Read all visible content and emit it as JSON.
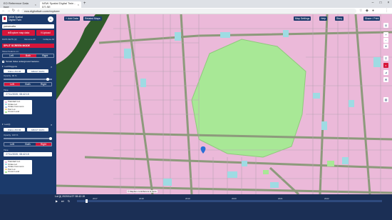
{
  "browser": {
    "tabs": [
      {
        "label": "EO Reference Data type"
      },
      {
        "label": "NSW Spatial Digital Twin - DT-SE"
      }
    ],
    "url": "nsw.digitaltwin.com/explorer"
  },
  "panel": {
    "app_title_line1": "NSW Spatial",
    "app_title_line2": "Digital Twin",
    "search_value": "parramatta",
    "explore_btn": "Explore map data",
    "upload_btn": "Upload",
    "data_sets": "DATA SETS (2)",
    "remove_all": "Remove All",
    "collapse_all": "Collapse All",
    "split_title": "SPLIT SCREEN MODE",
    "show_feature_on": "Show Feature on:",
    "sides": [
      "Left",
      "Both",
      "Right"
    ],
    "terrain_check": "Terrain hides underground features",
    "layer1_name": "Lot Polygons",
    "ideal_zoom": "IDEAL ZOOM",
    "about_data": "ABOUT DATA",
    "opacity": "Opacity: 90 %",
    "time_label": "Time",
    "time1": "27/11/2020, 08:42:15",
    "legend_items": [
      "Standard Lot",
      "Strata Lot",
      "Strata Commons",
      "Part Lot",
      "Crown Land"
    ],
    "layer2_name": "Lot (t)",
    "time2": "27/11/2020, 08:42:15",
    "opacity2": "Opacity: 100 %"
  },
  "map_ui": {
    "add_data": "Add Data",
    "related_maps": "Related Maps",
    "map_settings": "Map Settings",
    "help": "Help",
    "story": "Story",
    "share": "Share / Print",
    "attribution": "© Mapbox contributors & more"
  },
  "timeline": {
    "current": "Lot (t) 2020/11/27 08:42:15",
    "ticks": [
      "2017",
      "2018",
      "2019",
      "2020",
      "2021",
      "2022"
    ]
  },
  "colors": {
    "panel": "#1b3a6b",
    "accent": "#d7153a",
    "lot_pink": "#ebb9d9",
    "park_green": "#a8e896",
    "cyan_lot": "#9edbe3"
  }
}
